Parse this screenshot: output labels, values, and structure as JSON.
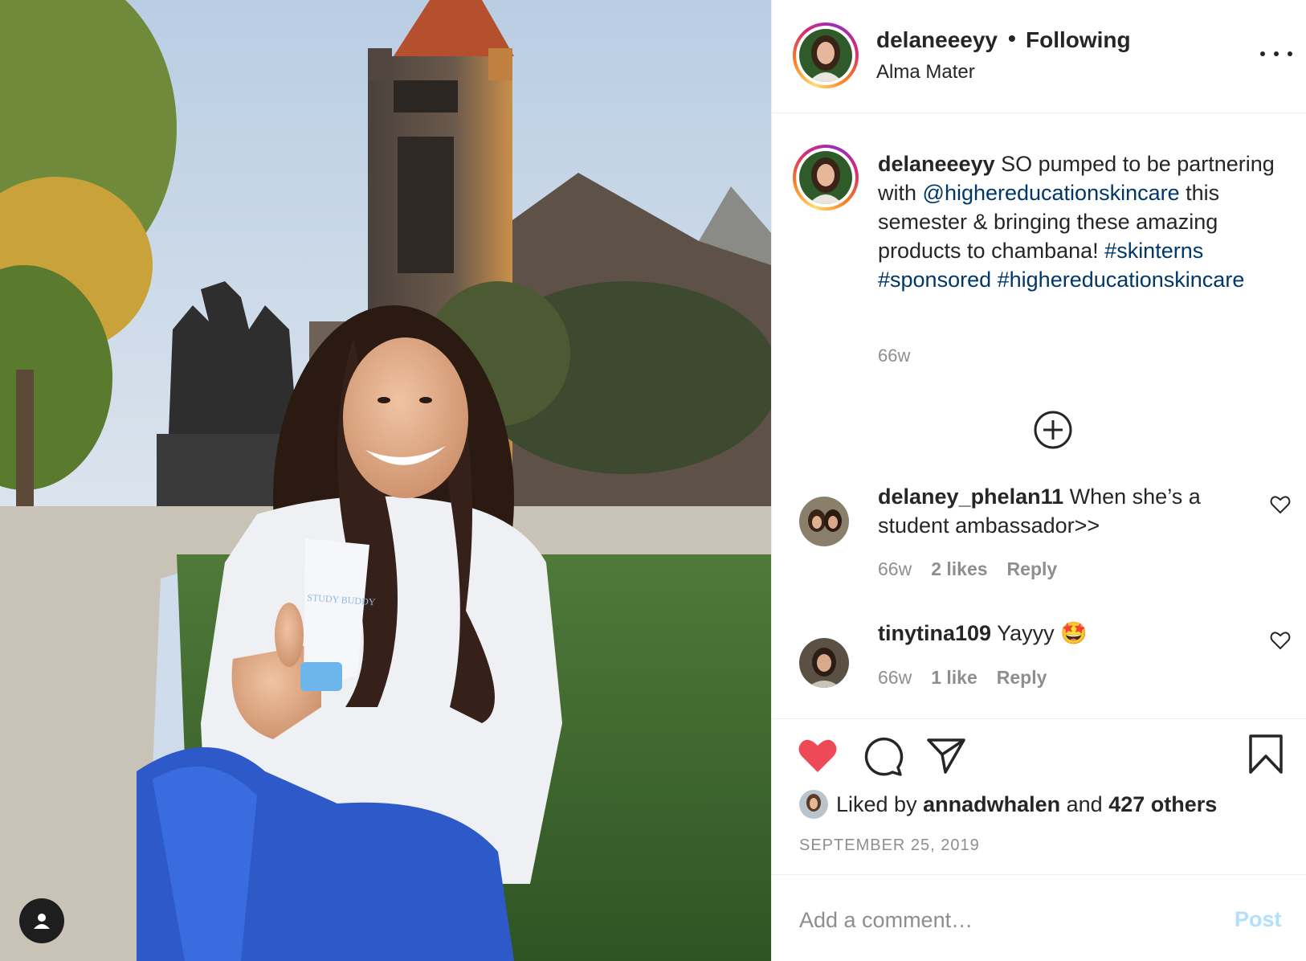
{
  "post": {
    "username": "delaneeeyy",
    "follow_dot": "•",
    "follow_status": "Following",
    "location": "Alma Mater",
    "photo_alt": "Woman holding skincare product in front of campus building"
  },
  "caption": {
    "username": "delaneeeyy",
    "text_1": " SO pumped to be partnering with ",
    "mention": "@highereducationskincare",
    "text_2": " this semester & bringing these amazing products to chambana! ",
    "hashtag_1": "#skinterns",
    "hashtag_2": "#sponsored",
    "hashtag_3": "#highereducationskincare",
    "time": "66w",
    "product_label": "STUDY BUDDY"
  },
  "comments": [
    {
      "username": "delaney_phelan11",
      "text": " When she’s a student ambassador>>",
      "time": "66w",
      "likes": "2 likes",
      "reply": "Reply"
    },
    {
      "username": "tinytina109",
      "text": " Yayyy 🤩",
      "time": "66w",
      "likes": "1 like",
      "reply": "Reply"
    }
  ],
  "likes": {
    "prefix": "Liked by ",
    "user": "annadwhalen",
    "middle": " and ",
    "others": "427 others"
  },
  "date": "SEPTEMBER 25, 2019",
  "add_comment": {
    "placeholder": "Add a comment…",
    "post_label": "Post"
  },
  "icons": {
    "like": "heart-filled-icon",
    "comment": "comment-bubble-icon",
    "share": "paper-plane-icon",
    "save": "bookmark-icon",
    "more": "more-options-icon",
    "load_more": "plus-circle-icon",
    "tag": "user-tag-icon"
  },
  "colors": {
    "like_red": "#ed4956",
    "link_blue": "#00376b",
    "meta_gray": "#8e8e8e",
    "post_disabled": "#b2dffc"
  }
}
